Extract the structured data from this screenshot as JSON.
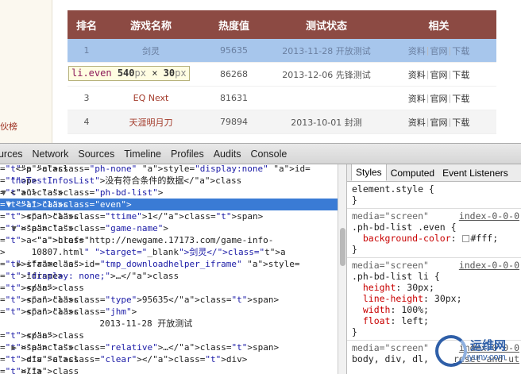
{
  "page": {
    "left_text": "伙榜",
    "table": {
      "headers": [
        "排名",
        "游戏名称",
        "热度值",
        "测试状态",
        "相关"
      ],
      "rows": [
        {
          "rank": "1",
          "name": "剑灵",
          "heat": "95635",
          "status": "2013-11-28 开放测试",
          "links": [
            "资料",
            "官网",
            "下载"
          ]
        },
        {
          "rank": "2",
          "name": "",
          "heat": "86268",
          "status": "2013-12-06 先锋测试",
          "links": [
            "资料",
            "官网",
            "下载"
          ]
        },
        {
          "rank": "3",
          "name": "EQ Next",
          "heat": "81631",
          "status": "",
          "links": [
            "资料",
            "官网",
            "下载"
          ]
        },
        {
          "rank": "4",
          "name": "天涯明月刀",
          "heat": "79894",
          "status": "2013-10-01 封测",
          "links": [
            "资料",
            "官网",
            "下载"
          ]
        }
      ]
    },
    "tooltip": {
      "selector": "li.even",
      "width": "540",
      "height": "30",
      "unit": "px",
      "times": "×"
    }
  },
  "devtools": {
    "tabs": [
      "ources",
      "Network",
      "Sources",
      "Timeline",
      "Profiles",
      "Audits",
      "Console"
    ],
    "dom_lines": [
      {
        "indent": 3,
        "tri": "",
        "html": "<p class=\"ph-none\" style=\"display:none\" id="
      },
      {
        "indent": 2,
        "tri": "",
        "html": "\"noTestInfosList\">没有符合条件的数据</p>"
      },
      {
        "indent": 2,
        "tri": "▼",
        "html": "<ul class=\"ph-bd-list\">"
      },
      {
        "indent": 3,
        "tri": "▼",
        "html": "<li class=\"even\">",
        "selected": true
      },
      {
        "indent": 5,
        "tri": "",
        "html": "<span class=\"ttime\">1</span>"
      },
      {
        "indent": 4,
        "tri": "▼",
        "html": "<span class=\"game-name\">"
      },
      {
        "indent": 6,
        "tri": "",
        "html": "<a href=\"http://newgame.17173.com/game-info-"
      },
      {
        "indent": 6,
        "tri": "",
        "html": "10807.html\" target=\"_blank\">剑灵</a>"
      },
      {
        "indent": 5,
        "tri": "▶",
        "html": "<iframe id=\"tmp_downloadhelper_iframe\" style="
      },
      {
        "indent": 5,
        "tri": "",
        "html": "\"display: none;\">…</iframe>"
      },
      {
        "indent": 5,
        "tri": "",
        "html": "</span>"
      },
      {
        "indent": 5,
        "tri": "",
        "html": "<span class=\"type\">95635</span>"
      },
      {
        "indent": 5,
        "tri": "",
        "html": "<span class=\"jhm\">"
      },
      {
        "indent": 19,
        "tri": "",
        "html": "2013-11-28 开放测试"
      },
      {
        "indent": 5,
        "tri": "",
        "html": "</span>"
      },
      {
        "indent": 4,
        "tri": "▶",
        "html": "<span class=\"relative\">…</span>"
      },
      {
        "indent": 5,
        "tri": "",
        "html": "<div class=\"clear\"></div>"
      },
      {
        "indent": 4,
        "tri": "",
        "html": "</li>"
      }
    ],
    "styles_tabs": [
      "Styles",
      "Computed",
      "Event Listeners"
    ],
    "styles": {
      "element_style": "element.style {",
      "close": "}",
      "rule1": {
        "media": "media=\"screen\"",
        "source": "index-0-0-0",
        "selector": ".ph-bd-list .even {",
        "props": [
          {
            "name": "background-color",
            "value": "#fff;"
          }
        ]
      },
      "rule2": {
        "media": "media=\"screen\"",
        "source": "index-0-0-0",
        "selector": ".ph-bd-list li {",
        "props": [
          {
            "name": "height",
            "value": "30px;"
          },
          {
            "name": "line-height",
            "value": "30px;"
          },
          {
            "name": "width",
            "value": "100%;"
          },
          {
            "name": "float",
            "value": "left;"
          }
        ]
      },
      "rule3": {
        "media": "media=\"screen\"",
        "source": "index-0-0-0",
        "selector": "body, div, dl,",
        "source2": "reset-and-ut"
      }
    }
  },
  "watermark": {
    "line1": "运维网",
    "line2": "iyunv.com"
  }
}
